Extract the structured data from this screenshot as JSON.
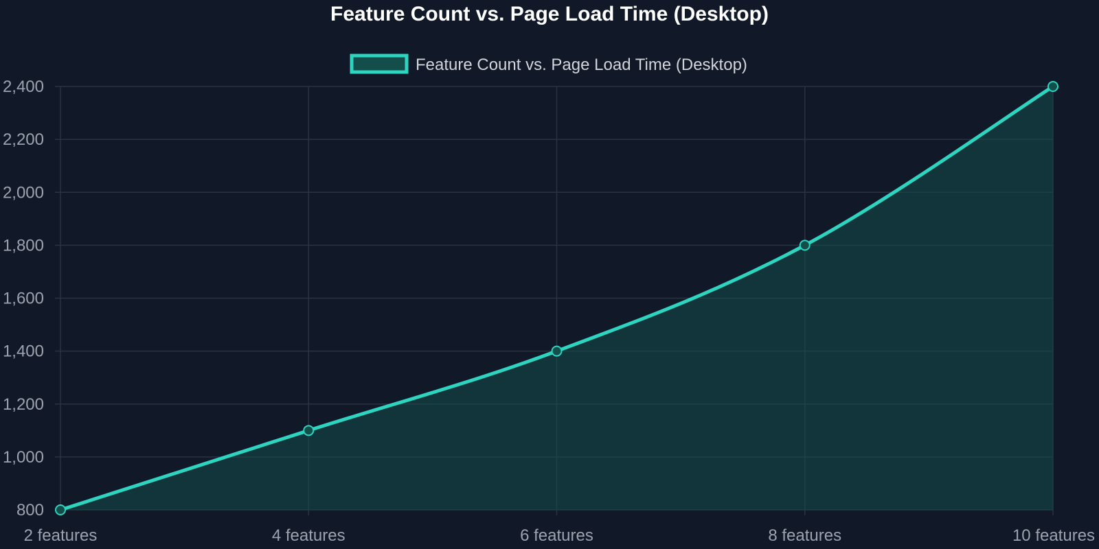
{
  "colors": {
    "background": "#111827",
    "series_line": "#2dd4bf",
    "series_fill": "#134e4a",
    "grid": "#2a3342",
    "tick_text": "#9ca3af",
    "legend_text": "#d1d5db",
    "title_text": "#ffffff"
  },
  "chart_data": {
    "type": "line",
    "title": "Feature Count vs. Page Load Time (Desktop)",
    "xlabel": "",
    "ylabel": "",
    "categories": [
      "2 features",
      "4 features",
      "6 features",
      "8 features",
      "10 features"
    ],
    "series": [
      {
        "name": "Feature Count vs. Page Load Time (Desktop)",
        "values": [
          800,
          1100,
          1400,
          1800,
          2400
        ]
      }
    ],
    "ylim": [
      800,
      2400
    ],
    "yticks": [
      800,
      1000,
      1200,
      1400,
      1600,
      1800,
      2000,
      2200,
      2400
    ],
    "ytick_labels": [
      "800",
      "1,000",
      "1,200",
      "1,400",
      "1,600",
      "1,800",
      "2,000",
      "2,200",
      "2,400"
    ],
    "grid": true,
    "fill": true,
    "smooth": true,
    "legend_position": "top-center"
  }
}
